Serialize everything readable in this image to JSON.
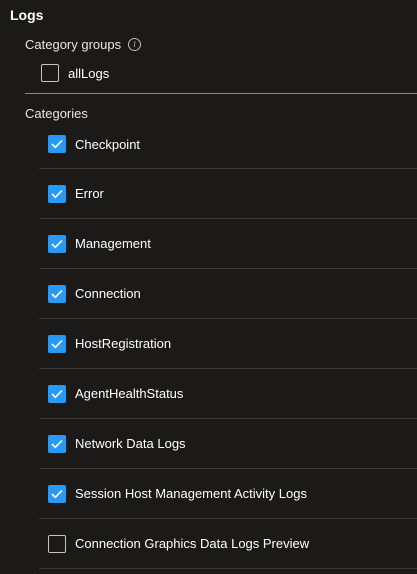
{
  "logs": {
    "title": "Logs",
    "category_groups": {
      "label": "Category groups",
      "items": [
        {
          "label": "allLogs",
          "checked": false
        }
      ]
    },
    "categories": {
      "label": "Categories",
      "items": [
        {
          "label": "Checkpoint",
          "checked": true
        },
        {
          "label": "Error",
          "checked": true
        },
        {
          "label": "Management",
          "checked": true
        },
        {
          "label": "Connection",
          "checked": true
        },
        {
          "label": "HostRegistration",
          "checked": true
        },
        {
          "label": "AgentHealthStatus",
          "checked": true
        },
        {
          "label": "Network Data Logs",
          "checked": true
        },
        {
          "label": "Session Host Management Activity Logs",
          "checked": true
        },
        {
          "label": "Connection Graphics Data Logs Preview",
          "checked": false
        }
      ]
    }
  },
  "colors": {
    "background": "#1b1a19",
    "checkbox_checked": "#2899f5",
    "divider": "#3b3a39"
  },
  "icons": {
    "info": "info-icon",
    "check": "checkmark-icon"
  }
}
